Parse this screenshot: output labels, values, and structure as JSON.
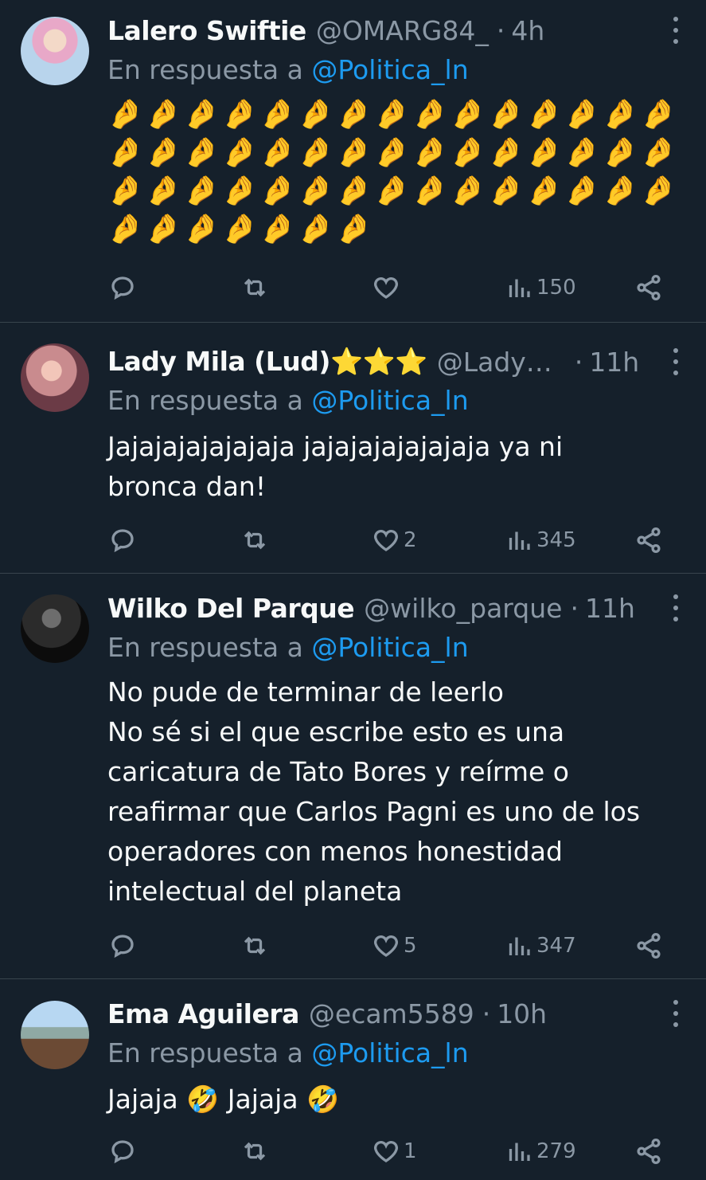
{
  "colors": {
    "background": "#15202b",
    "text": "#f7f9f9",
    "muted": "#8b98a5",
    "link": "#1d9bf0",
    "divider": "#38444d"
  },
  "reply_prefix": "En respuesta a",
  "tweets": [
    {
      "name": "Lalero Swiftie",
      "handle": "@OMARG84_",
      "dot": "·",
      "time": "4h",
      "reply_to": "@Politica_ln",
      "body": "🤌🤌🤌🤌🤌🤌🤌🤌🤌🤌🤌🤌🤌🤌🤌🤌🤌🤌🤌🤌🤌🤌🤌🤌🤌🤌🤌🤌🤌🤌🤌🤌🤌🤌🤌🤌🤌🤌🤌🤌🤌🤌🤌🤌🤌🤌🤌🤌🤌🤌🤌🤌",
      "likes": "",
      "views": "150"
    },
    {
      "name": "Lady Mila (Lud)⭐⭐⭐",
      "handle": "@Lady…",
      "dot": "·",
      "time": "11h",
      "reply_to": "@Politica_ln",
      "body": "Jajajajajajajaja jajajajajajajaja ya ni\nbronca dan!",
      "likes": "2",
      "views": "345"
    },
    {
      "name": "Wilko Del Parque",
      "handle": "@wilko_parque",
      "dot": "·",
      "time": "11h",
      "reply_to": "@Politica_ln",
      "body": "No pude de terminar de leerlo\nNo sé si el que escribe esto es una\ncaricatura de Tato Bores y reírme o\nreafirmar que Carlos Pagni es uno de los\noperadores con menos honestidad\nintelectual del planeta",
      "likes": "5",
      "views": "347"
    },
    {
      "name": "Ema Aguilera",
      "handle": "@ecam5589",
      "dot": "·",
      "time": "10h",
      "reply_to": "@Politica_ln",
      "body": "Jajaja 🤣 Jajaja 🤣",
      "likes": "1",
      "views": "279"
    }
  ]
}
